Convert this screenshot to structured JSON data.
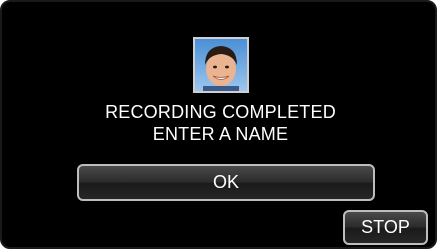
{
  "dialog": {
    "line1": "RECORDING COMPLETED",
    "line2": "ENTER A NAME"
  },
  "buttons": {
    "ok_label": "OK",
    "stop_label": "STOP"
  },
  "colors": {
    "background": "#000000",
    "text": "#ffffff",
    "button_border": "#bdbdbd"
  },
  "icons": {
    "face": "face-thumbnail"
  }
}
